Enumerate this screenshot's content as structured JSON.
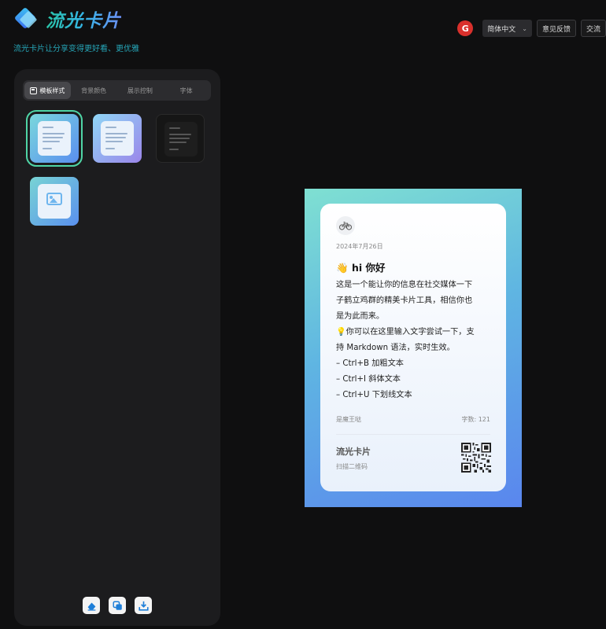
{
  "app": {
    "name": "流光卡片",
    "tagline": "流光卡片让分享变得更好看、更优雅"
  },
  "header": {
    "language": "简体中文",
    "feedback": "意见反馈",
    "community": "交流"
  },
  "tabs": [
    {
      "label": "模板样式",
      "active": true
    },
    {
      "label": "背景颜色",
      "active": false
    },
    {
      "label": "展示控制",
      "active": false
    },
    {
      "label": "字体",
      "active": false
    }
  ],
  "templates": [
    {
      "name": "blue-gradient",
      "selected": true
    },
    {
      "name": "purple-gradient",
      "selected": false
    },
    {
      "name": "dark",
      "selected": false
    },
    {
      "name": "image",
      "selected": false
    }
  ],
  "actions": [
    "clear-icon",
    "copy-icon",
    "download-icon"
  ],
  "card": {
    "date": "2024年7月26日",
    "title_emoji": "👋",
    "title": "hi 你好",
    "lines": [
      "这是一个能让你的信息在社交媒体一下",
      "子鹤立鸡群的精美卡片工具，相信你也",
      "是为此而来。",
      "💡你可以在这里输入文字尝试一下，支",
      "持 Markdown 语法，实时生效。",
      "– Ctrl+B 加粗文本",
      "– Ctrl+I 斜体文本",
      "– Ctrl+U 下划线文本"
    ],
    "author": "是魔王哒",
    "word_count": "字数: 121",
    "brand": "流光卡片",
    "scan_hint": "扫描二维码"
  },
  "colors": {
    "accent": "#4fd5a6",
    "tagline": "#26a6b8",
    "brand_red": "#d9302c"
  }
}
